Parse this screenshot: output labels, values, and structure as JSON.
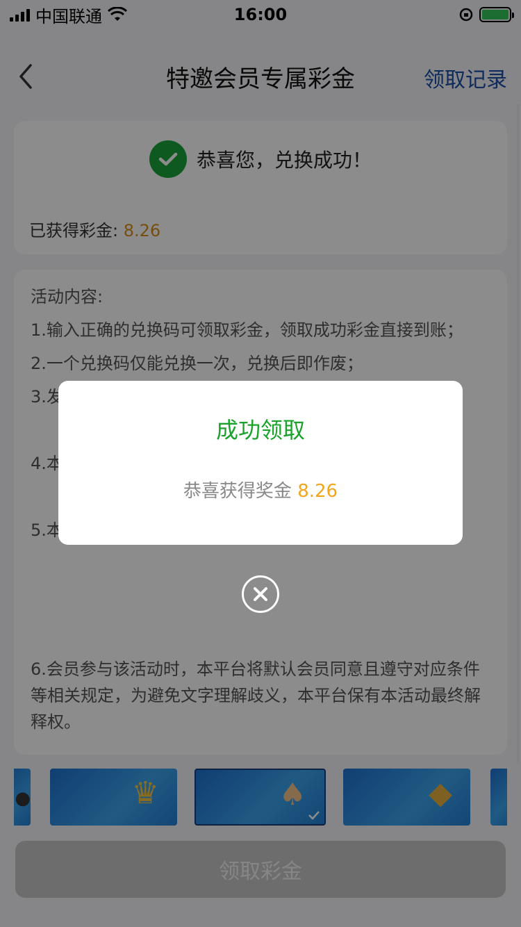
{
  "status_bar": {
    "carrier": "中国联通",
    "time": "16:00"
  },
  "header": {
    "title": "特邀会员专属彩金",
    "right_link": "领取记录"
  },
  "success_card": {
    "message": "恭喜您，兑换成功！",
    "earned_label": "已获得彩金:",
    "earned_amount": "8.26"
  },
  "rules": {
    "heading": "活动内容:",
    "items": [
      "1.输入正确的兑换码可领取彩金，领取成功彩金直接到账；",
      "2.一个兑换码仅能兑换一次，兑换后即作废；",
      "3.发",
      "4.本",
      "5.本",
      "6.会员参与该活动时，本平台将默认会员同意且遵守对应条件等相关规定，为避免文字理解歧义，本平台保有本活动最终解释权。"
    ]
  },
  "claim_button": {
    "label": "领取彩金"
  },
  "modal": {
    "title": "成功领取",
    "body_label": "恭喜获得奖金",
    "amount": "8.26"
  },
  "colors": {
    "success_green": "#1aa32a",
    "amount_orange": "#f3a51c",
    "link_blue": "#1b4fa8"
  }
}
